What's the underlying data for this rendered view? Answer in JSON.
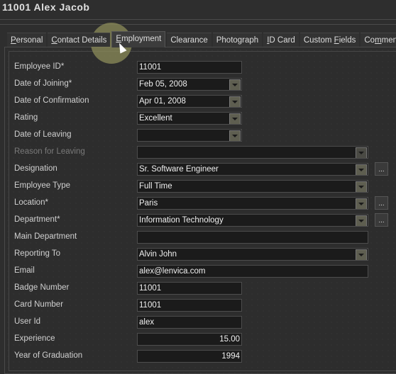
{
  "header": {
    "title": "11001  Alex Jacob"
  },
  "tabs": [
    {
      "label": "Personal",
      "ul": 0
    },
    {
      "label": "Contact Details",
      "ul": 0
    },
    {
      "label": "Employment",
      "ul": 0,
      "active": true
    },
    {
      "label": "Clearance",
      "ul": -1
    },
    {
      "label": "Photograph",
      "ul": -1
    },
    {
      "label": "ID Card",
      "ul": 0
    },
    {
      "label": "Custom Fields",
      "ul": 7
    },
    {
      "label": "Comments",
      "ul": 2
    }
  ],
  "form": [
    {
      "label": "Employee ID*",
      "value": "11001",
      "type": "text",
      "size": "short"
    },
    {
      "label": "Date of Joining*",
      "value": "Feb 05, 2008",
      "type": "combo",
      "size": "short"
    },
    {
      "label": "Date of Confirmation",
      "value": "Apr 01, 2008",
      "type": "combo",
      "size": "short"
    },
    {
      "label": "Rating",
      "value": "Excellent",
      "type": "combo",
      "size": "short"
    },
    {
      "label": "Date of Leaving",
      "value": "",
      "type": "combo",
      "size": "short"
    },
    {
      "label": "Reason for Leaving",
      "value": "",
      "type": "combo",
      "size": "long",
      "disabled": true
    },
    {
      "label": "Designation",
      "value": "Sr. Software Engineer",
      "type": "combo",
      "size": "long",
      "more": true
    },
    {
      "label": "Employee Type",
      "value": "Full Time",
      "type": "combo",
      "size": "long"
    },
    {
      "label": "Location*",
      "value": "Paris",
      "type": "combo",
      "size": "long",
      "more": true
    },
    {
      "label": "Department*",
      "value": "Information Technology",
      "type": "combo",
      "size": "long",
      "more": true
    },
    {
      "label": "Main Department",
      "value": "",
      "type": "text",
      "size": "long"
    },
    {
      "label": "Reporting To",
      "value": "Alvin John",
      "type": "combo",
      "size": "long"
    },
    {
      "label": "Email",
      "value": "alex@lenvica.com",
      "type": "text",
      "size": "long"
    },
    {
      "label": "Badge Number",
      "value": "11001",
      "type": "text",
      "size": "short"
    },
    {
      "label": "Card Number",
      "value": "11001",
      "type": "text",
      "size": "short"
    },
    {
      "label": "User Id",
      "value": "alex",
      "type": "text",
      "size": "short"
    },
    {
      "label": "Experience",
      "value": "15.00",
      "type": "text",
      "size": "short",
      "align": "right"
    },
    {
      "label": "Year of Graduation",
      "value": "1994",
      "type": "text",
      "size": "short",
      "align": "right"
    }
  ],
  "more_label": "..."
}
